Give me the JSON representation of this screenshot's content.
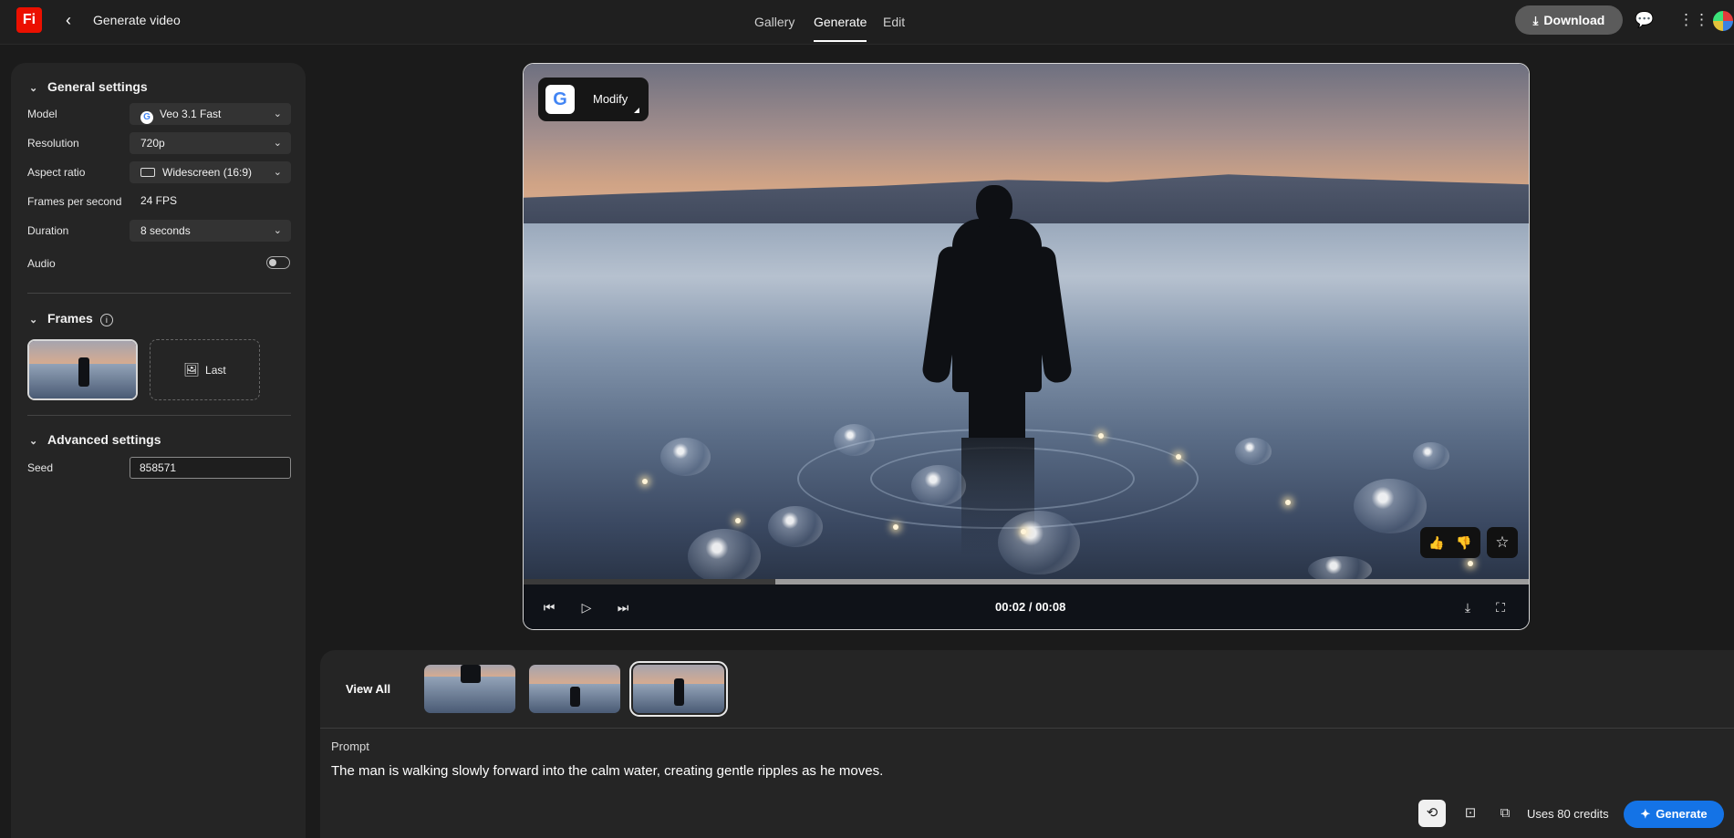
{
  "app": {
    "logo_text": "Fi",
    "title": "Generate video",
    "brand_color": "#eb1000",
    "accent_color": "#1473e6"
  },
  "nav": {
    "tabs": [
      {
        "label": "Gallery",
        "active": false
      },
      {
        "label": "Generate",
        "active": true
      },
      {
        "label": "Edit",
        "active": false
      }
    ],
    "download_label": "Download"
  },
  "sidebar": {
    "general_heading": "General settings",
    "model_label": "Model",
    "model_value": "Veo 3.1 Fast",
    "resolution_label": "Resolution",
    "resolution_value": "720p",
    "aspect_label": "Aspect ratio",
    "aspect_value": "Widescreen (16:9)",
    "fps_label": "Frames per second",
    "fps_value": "24 FPS",
    "duration_label": "Duration",
    "duration_value": "8 seconds",
    "audio_label": "Audio",
    "audio_on": false,
    "frames_heading": "Frames",
    "last_frame_label": "Last",
    "advanced_heading": "Advanced settings",
    "seed_label": "Seed",
    "seed_value": "858571"
  },
  "player": {
    "modify_label": "Modify",
    "time_display": "00:02 / 00:08",
    "progress_fraction": 0.25
  },
  "bottom": {
    "view_all_label": "View All",
    "prompt_label": "Prompt",
    "prompt_text": "The man is walking slowly forward into the calm water, creating gentle ripples as he moves.",
    "credits_text": "Uses 80 credits",
    "generate_label": "Generate"
  }
}
